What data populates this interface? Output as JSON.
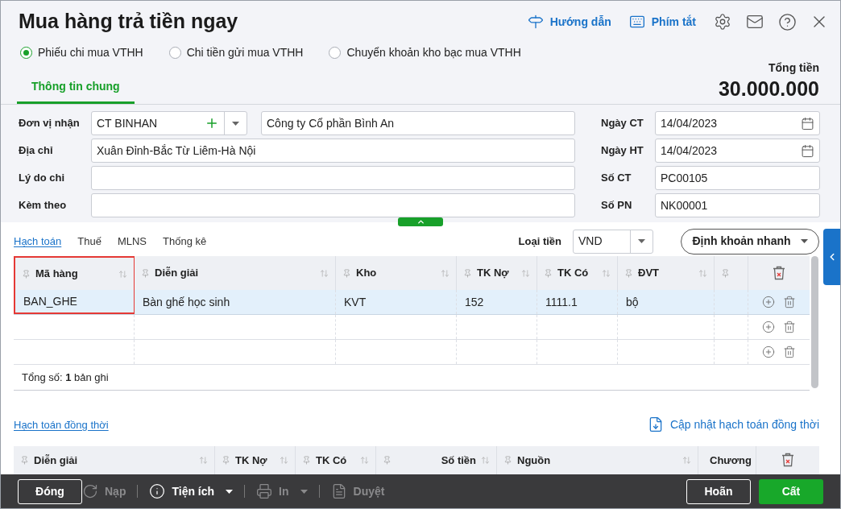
{
  "title": "Mua hàng trả tiền ngay",
  "header_actions": [
    {
      "label": "Hướng dẫn",
      "kind": "guide"
    },
    {
      "label": "Phím tắt",
      "kind": "keyboard"
    }
  ],
  "voucher_types": [
    {
      "label": "Phiếu chi mua VTHH",
      "selected": true
    },
    {
      "label": "Chi tiền gửi mua VTHH",
      "selected": false
    },
    {
      "label": "Chuyển khoản kho bạc mua VTHH",
      "selected": false
    }
  ],
  "total": {
    "label": "Tổng tiền",
    "value": "30.000.000"
  },
  "tabs": [
    {
      "label": "Thông tin chung",
      "selected": true
    }
  ],
  "form_left": [
    {
      "label": "Đơn vị nhận",
      "kind": "combo",
      "code": "CT BINHAN",
      "value": "Công ty Cổ phần Bình An"
    },
    {
      "label": "Địa chỉ",
      "kind": "text",
      "value": "Xuân Đỉnh-Bắc Từ Liêm-Hà Nội"
    },
    {
      "label": "Lý do chi",
      "kind": "text"
    },
    {
      "label": "Kèm theo",
      "kind": "text"
    }
  ],
  "form_right": [
    {
      "label": "Ngày CT",
      "kind": "date",
      "value": "14/04/2023"
    },
    {
      "label": "Ngày HT",
      "kind": "date",
      "value": "14/04/2023"
    },
    {
      "label": "Số CT",
      "kind": "text",
      "value": "PC00105"
    },
    {
      "label": "Số PN",
      "kind": "text",
      "value": "NK00001"
    }
  ],
  "detail_tabs": [
    {
      "label": "Hạch toán",
      "selected": true
    },
    {
      "label": "Thuế",
      "selected": false
    },
    {
      "label": "MLNS",
      "selected": false
    },
    {
      "label": "Thống kê",
      "selected": false
    }
  ],
  "currency": {
    "label": "Loại tiền",
    "value": "VND"
  },
  "quick_entry": "Định khoản nhanh",
  "grid": {
    "columns": [
      {
        "label": "Mã hàng",
        "highlighted": true
      },
      {
        "label": "Diễn giải",
        "highlighted": false
      },
      {
        "label": "Kho",
        "highlighted": false
      },
      {
        "label": "TK Nợ",
        "highlighted": false
      },
      {
        "label": "TK Có",
        "highlighted": false
      },
      {
        "label": "ĐVT",
        "highlighted": false
      },
      {
        "highlighted": false
      }
    ],
    "rows": [
      {
        "selected": true,
        "cells": [
          "BAN_GHE",
          "Bàn ghế học sinh",
          "KVT",
          "152",
          "1111.1",
          "bộ"
        ]
      },
      {
        "selected": false
      },
      {
        "selected": false
      }
    ],
    "summary": "Tổng số: **1** bản ghi"
  },
  "concurrent": {
    "link": "Hạch toán đồng thời",
    "action": "Cập nhật hạch toán đồng thời",
    "columns": [
      {
        "label": "Diễn giải"
      },
      {
        "label": "TK Nợ"
      },
      {
        "label": "TK Có"
      },
      {
        "label": "Số tiền"
      },
      {
        "label": "Nguồn"
      },
      {
        "label": "Chương"
      }
    ]
  },
  "footer": [
    {
      "label": "Đóng",
      "kind": "outline",
      "disabled": false,
      "menu": false
    },
    {
      "label": "Nạp",
      "kind": "reload",
      "disabled": true,
      "menu": false
    },
    {
      "label": "Tiện ích",
      "kind": "utilities",
      "disabled": false,
      "menu": true
    },
    {
      "label": "In",
      "kind": "print",
      "disabled": true,
      "menu": true
    },
    {
      "label": "Duyệt",
      "kind": "approve",
      "disabled": true,
      "menu": false
    },
    {
      "label": "Hoãn",
      "kind": "outline",
      "disabled": false,
      "menu": false
    },
    {
      "label": "Cất",
      "kind": "primary",
      "disabled": false,
      "menu": false
    }
  ]
}
